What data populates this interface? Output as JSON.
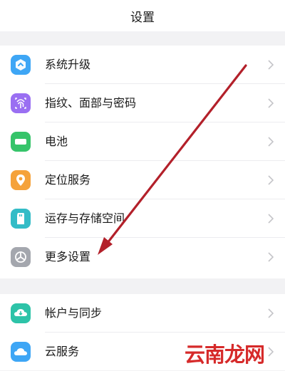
{
  "header": {
    "title": "设置"
  },
  "settings": {
    "system_update": {
      "label": "系统升级",
      "icon": "system-update-icon",
      "color": "#3ea6f5"
    },
    "fingerprint": {
      "label": "指纹、面部与密码",
      "icon": "fingerprint-icon",
      "color": "#9a6ff2"
    },
    "battery": {
      "label": "电池",
      "icon": "battery-icon",
      "color": "#36c46a"
    },
    "location": {
      "label": "定位服务",
      "icon": "location-pin-icon",
      "color": "#f5a23a"
    },
    "storage": {
      "label": "运存与存储空间",
      "icon": "sd-card-icon",
      "color": "#33bcc7"
    },
    "more_settings": {
      "label": "更多设置",
      "icon": "more-settings-icon",
      "color": "#a4a7ae"
    },
    "account_sync": {
      "label": "帐户与同步",
      "icon": "account-sync-icon",
      "color": "#2dc3a8"
    },
    "cloud_service": {
      "label": "云服务",
      "icon": "cloud-icon",
      "color": "#3ea6f5"
    }
  },
  "annotation": {
    "arrow_color": "#b3202a"
  },
  "watermark": {
    "text": "云南龙网"
  }
}
